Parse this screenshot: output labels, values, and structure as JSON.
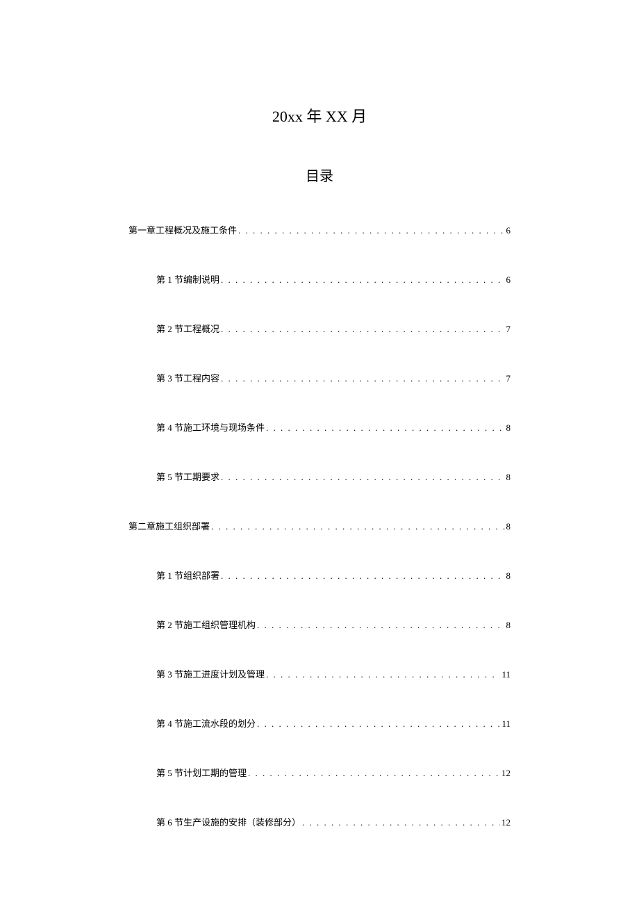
{
  "date_line": "20xx 年 XX 月",
  "toc_title": "目录",
  "toc": [
    {
      "level": 1,
      "label": "第一章工程概况及施工条件",
      "page": "6"
    },
    {
      "level": 2,
      "label": "第 1 节编制说明",
      "page": "6"
    },
    {
      "level": 2,
      "label": "第 2 节工程概况",
      "page": "7"
    },
    {
      "level": 2,
      "label": "第 3 节工程内容",
      "page": "7"
    },
    {
      "level": 2,
      "label": "第 4 节施工环境与现场条件",
      "page": "8"
    },
    {
      "level": 2,
      "label": "第 5 节工期要求",
      "page": "8"
    },
    {
      "level": 1,
      "label": "第二章施工组织部署",
      "page": "8"
    },
    {
      "level": 2,
      "label": "第 1 节组织部署",
      "page": "8"
    },
    {
      "level": 2,
      "label": "第 2 节施工组织管理机构",
      "page": "8"
    },
    {
      "level": 2,
      "label": "第 3 节施工进度计划及管理",
      "page": "11"
    },
    {
      "level": 2,
      "label": "第 4 节施工流水段的划分",
      "page": "11"
    },
    {
      "level": 2,
      "label": "第 5 节计划工期的管理",
      "page": "12"
    },
    {
      "level": 2,
      "label": "第 6 节生产设施的安排（装修部分）",
      "page": "12"
    }
  ]
}
